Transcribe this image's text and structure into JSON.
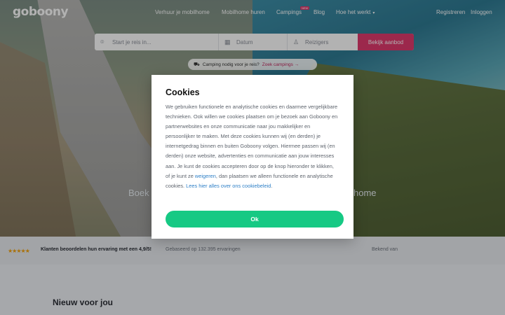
{
  "nav": {
    "logo": "goboony",
    "links": [
      {
        "label": "Verhuur je mobilhome"
      },
      {
        "label": "Mobilhome huren"
      },
      {
        "label": "Campings",
        "badge": "NEW"
      },
      {
        "label": "Blog"
      },
      {
        "label": "Hoe het werkt"
      }
    ],
    "register": "Registreren",
    "login": "Inloggen"
  },
  "search": {
    "where_placeholder": "Start je reis in...",
    "date_placeholder": "Datum",
    "travelers_placeholder": "Reizigers",
    "button": "Bekijk aanbod"
  },
  "camping_pill": {
    "text": "Camping nodig voor je reis?",
    "link": "Zoek campings →"
  },
  "hero": {
    "text_left": "Boek",
    "text_right": "home"
  },
  "trust": {
    "rating_stars": 4.5,
    "main": "Klanten beoordelen hun ervaring met een 4,9/5!",
    "sub": "Gebaseerd op 132.395 ervaringen",
    "known": "Bekend van"
  },
  "section": {
    "title": "Nieuw voor jou"
  },
  "cookie_modal": {
    "title": "Cookies",
    "body_1": "We gebruiken functionele en analytische cookies en daarmee vergelijkbare technieken. Ook willen we cookies plaatsen om je bezoek aan Goboony en partnerwebsites en onze communicatie naar jou makkelijker en persoonlijker te maken. Met deze cookies kunnen wij (en derden) je internetgedrag binnen en buiten Goboony volgen. Hiermee passen wij (en derden) onze website, advertenties en communicatie aan jouw interesses aan. Je kunt de cookies accepteren door op de knop hieronder te klikken, of je kunt ze ",
    "refuse_link": "weigeren",
    "body_2": ", dan plaatsen we alleen functionele en analytische cookies. ",
    "policy_link": "Lees hier alles over ons cookiebeleid",
    "body_3": ".",
    "ok_button": "Ok"
  },
  "colors": {
    "accent": "#e03a6e",
    "ok_green": "#16c984",
    "link_blue": "#2f80c7",
    "star": "#f2a30f"
  },
  "icons": {
    "where": "map-pin-icon",
    "date": "calendar-icon",
    "travelers": "person-icon",
    "pill": "van-icon"
  }
}
